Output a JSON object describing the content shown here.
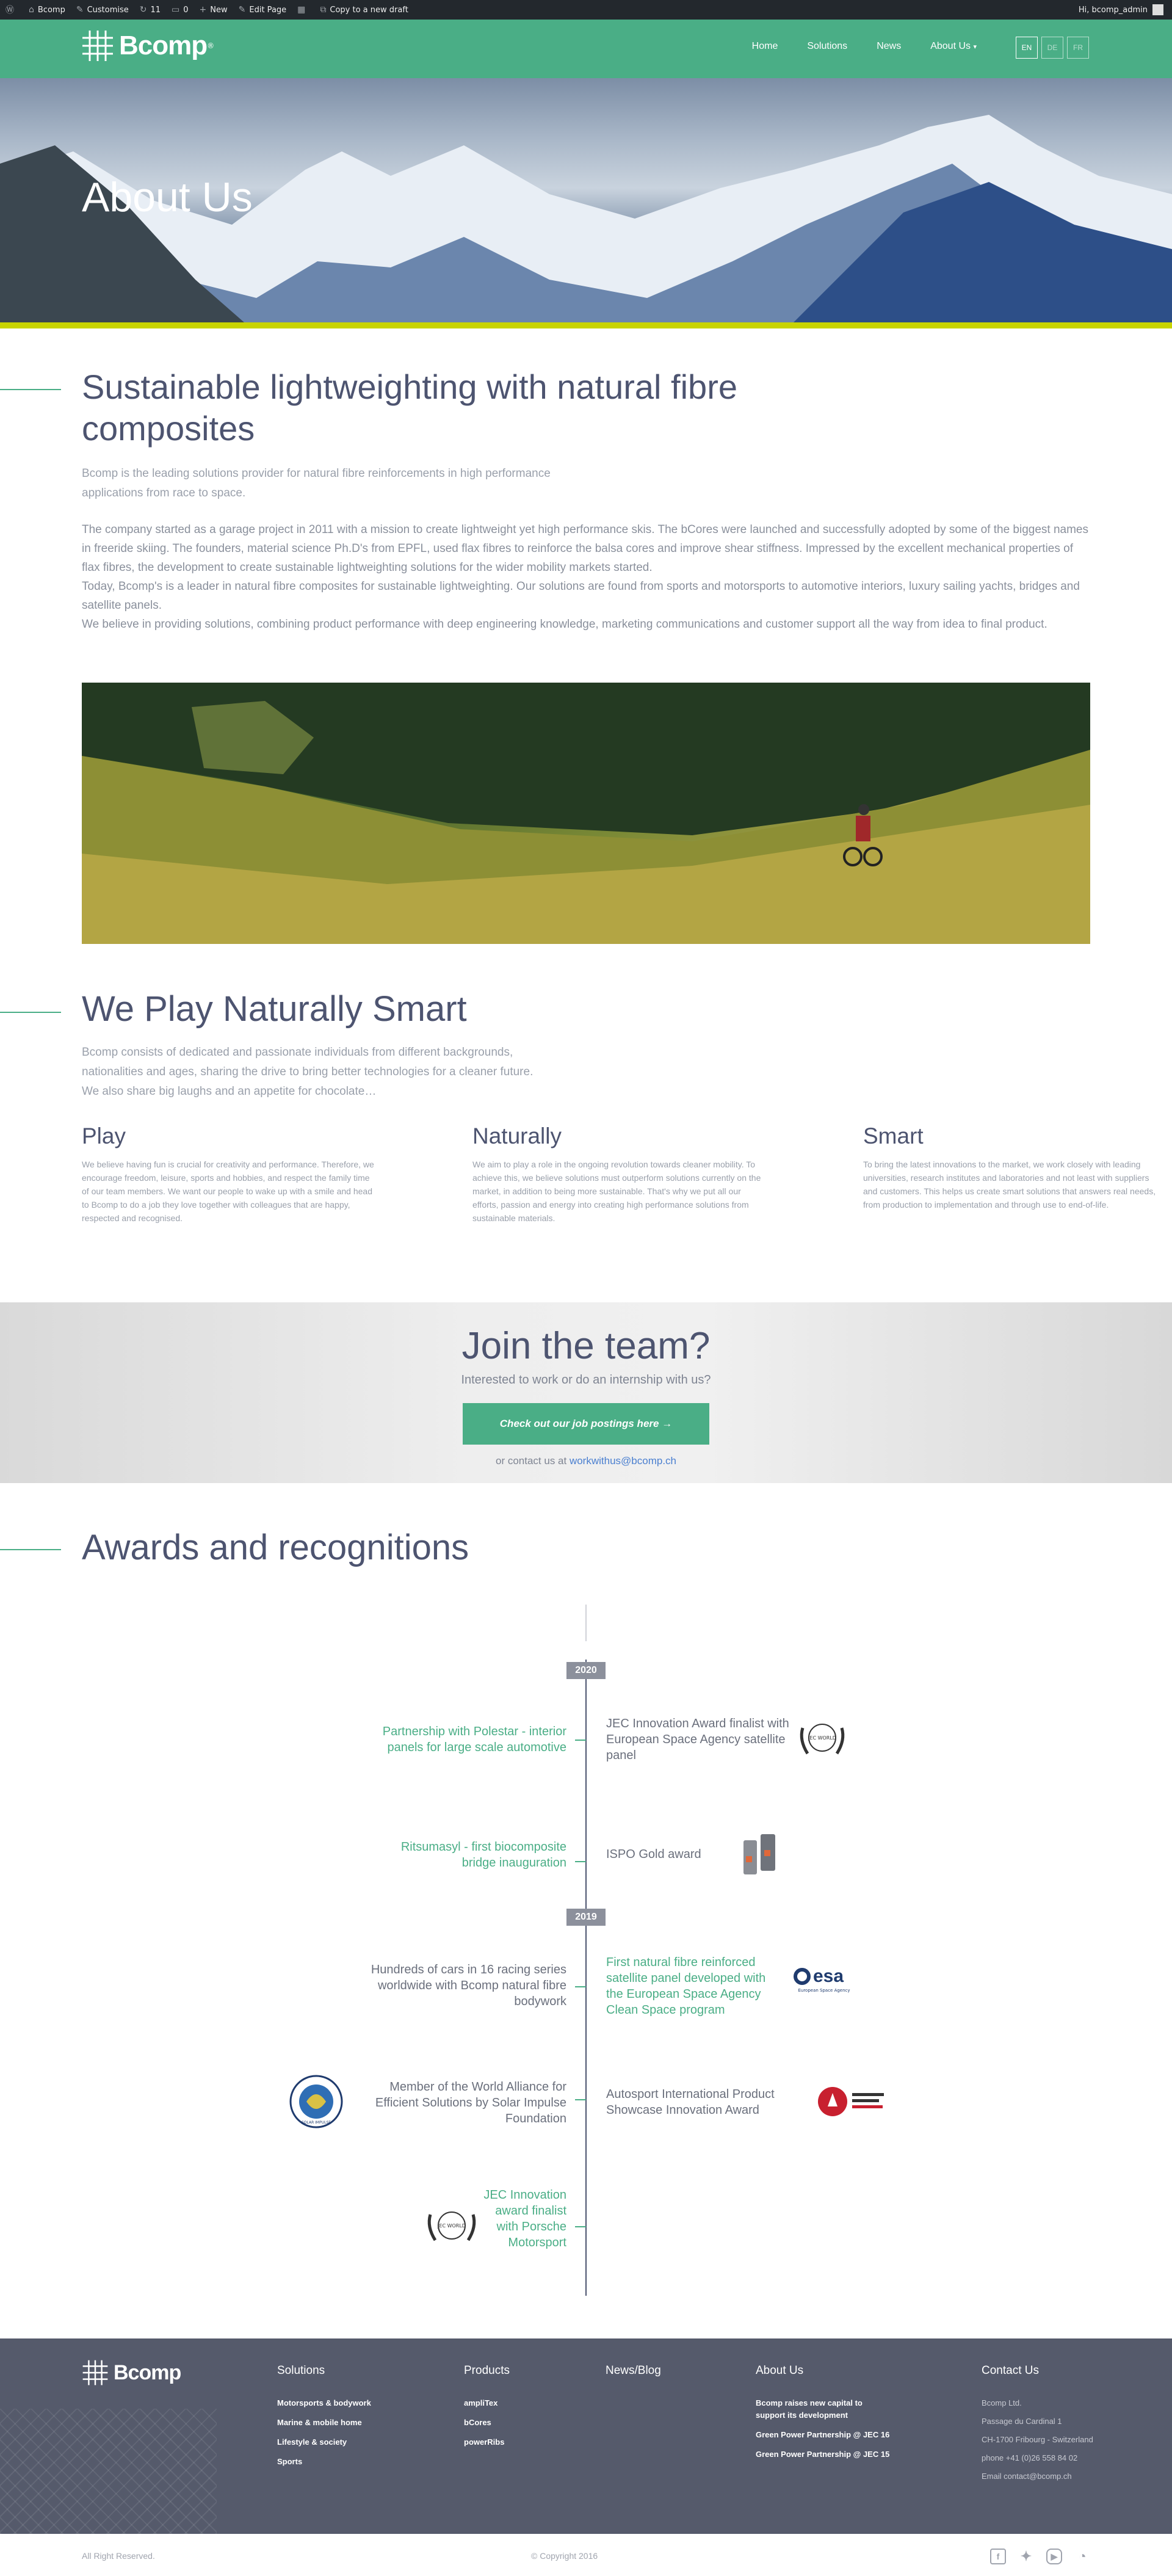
{
  "adminbar": {
    "site": "Bcomp",
    "customise": "Customise",
    "updates": "11",
    "comments": "0",
    "new": "New",
    "edit_page": "Edit Page",
    "copy": "Copy to a new draft",
    "greeting": "Hi, bcomp_admin"
  },
  "header": {
    "logo": "Bcomp",
    "logo_mark": "®",
    "nav": [
      "Home",
      "Solutions",
      "News",
      "About Us"
    ],
    "about_chevron": "▾",
    "langs": [
      "EN",
      "DE",
      "FR"
    ]
  },
  "hero": {
    "title": "About Us"
  },
  "intro": {
    "heading": "Sustainable lightweighting with natural fibre composites",
    "lead": "Bcomp is the leading solutions provider for natural fibre reinforcements in high performance applications from race to space.",
    "p1": "The company started as a garage project in 2011 with a mission to create lightweight yet high performance skis. The bCores were launched and successfully adopted by some of the biggest names in freeride skiing. The founders, material science Ph.D's from EPFL, used flax fibres to reinforce the balsa cores and improve shear stiffness. Impressed by the excellent mechanical properties of flax fibres, the development to create sustainable lightweighting solutions for the wider mobility markets started.",
    "p2": "Today, Bcomp's is a leader in natural fibre composites for sustainable lightweighting. Our solutions are found from sports and motorsports to automotive interiors, luxury sailing yachts, bridges and satellite panels.",
    "p3": "We believe in providing solutions, combining product performance with deep engineering knowledge, marketing communications and customer support all the way from idea to final product."
  },
  "play": {
    "heading": "We Play Naturally Smart",
    "lead": "Bcomp consists of dedicated and passionate individuals from different backgrounds, nationalities and ages, sharing the drive to bring better technologies for a cleaner future. We also share big laughs and an appetite for chocolate…",
    "columns": [
      {
        "title": "Play",
        "text": "We believe having fun is crucial for creativity and performance. Therefore, we encourage freedom, leisure, sports and hobbies, and respect the family time of our team members. We want our people to wake up with a smile and head to Bcomp to do a job they love together with colleagues that are happy, respected and recognised."
      },
      {
        "title": "Naturally",
        "text": "We aim to play a role in the ongoing revolution towards cleaner mobility. To achieve this, we believe solutions must outperform solutions currently on the market, in addition to being more sustainable. That's why we put all our efforts, passion and energy into creating high performance solutions from sustainable materials."
      },
      {
        "title": "Smart",
        "text": "To bring the latest innovations to the market, we work closely with leading universities, research institutes and laboratories and not least with suppliers and customers. This helps us create smart solutions that answers real needs, from production to implementation and through use to end-of-life."
      }
    ]
  },
  "join": {
    "heading": "Join the team?",
    "sub": "Interested to work or do an internship with us?",
    "button": "Check out our job postings here →",
    "contact_prefix": "or contact us at ",
    "email": "workwithus@bcomp.ch"
  },
  "awards": {
    "heading": "Awards and recognitions",
    "years": [
      "2020",
      "2019"
    ],
    "items": {
      "a1": "Partnership with Polestar - interior panels for large scale automotive",
      "a2": "JEC Innovation Award finalist with European Space Agency satellite panel",
      "a3": "Ritsumasyl - first biocomposite bridge inauguration",
      "a4": "ISPO Gold award",
      "a5": "Hundreds of cars in 16 racing series worldwide with Bcomp natural fibre bodywork",
      "a6": "First natural fibre reinforced satellite panel developed with the European Space Agency Clean Space program",
      "a7": "Member of the World Alliance for Efficient Solutions by Solar Impulse Foundation",
      "a8": "Autosport International Product Showcase Innovation Award",
      "a9": "JEC Innovation award finalist with Porsche Motorsport"
    },
    "badges": {
      "esa": "esa",
      "esa_sub": "European Space Agency",
      "jec": "JEC WORLD",
      "solar": "SOLAR IMPULSE"
    }
  },
  "footer": {
    "logo": "Bcomp",
    "solutions": {
      "title": "Solutions",
      "items": [
        "Motorsports & bodywork",
        "Marine & mobile home",
        "Lifestyle & society",
        "Sports"
      ]
    },
    "products": {
      "title": "Products",
      "items": [
        "ampliTex",
        "bCores",
        "powerRibs"
      ]
    },
    "news": {
      "title": "News/Blog"
    },
    "about": {
      "title": "About Us",
      "items": [
        "Bcomp raises new capital to support its development",
        "Green Power Partnership @ JEC 16",
        "Green Power Partnership @ JEC 15"
      ]
    },
    "contact": {
      "title": "Contact Us",
      "items": [
        "Bcomp Ltd.",
        "Passage du Cardinal 1",
        "CH-1700 Fribourg - Switzerland",
        "phone +41 (0)26 558 84 02",
        "Email contact@bcomp.ch"
      ]
    }
  },
  "bottom": {
    "rights": "All Right Reserved.",
    "copyright": "© Copyright 2016"
  }
}
